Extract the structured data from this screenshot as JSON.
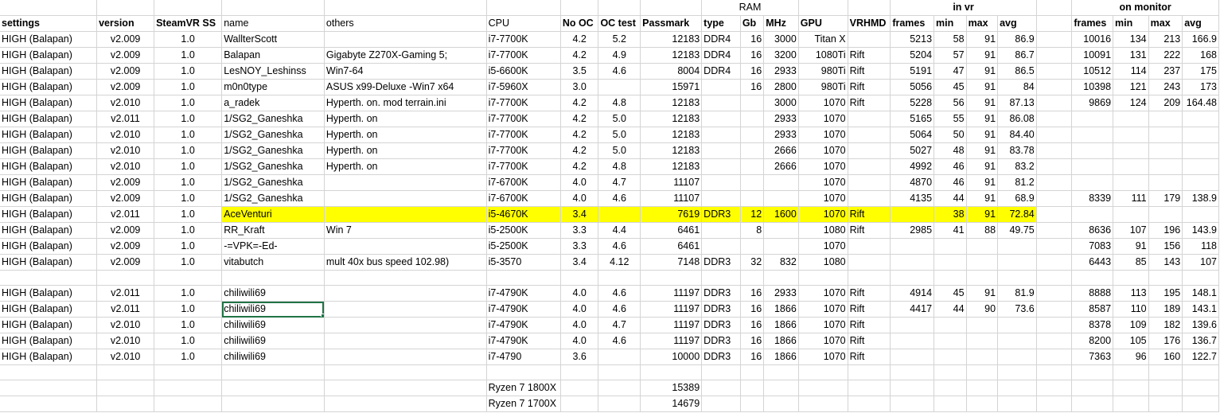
{
  "group_headers": {
    "ram": "RAM",
    "in_vr": "in vr",
    "on_monitor": "on monitor"
  },
  "headers": {
    "settings": "settings",
    "version": "version",
    "steamvr_ss": "SteamVR SS",
    "name": "name",
    "others": "others",
    "cpu": "CPU",
    "no_oc": "No OC",
    "oc_test": "OC test",
    "passmark": "Passmark",
    "ram_type": "type",
    "ram_gb": "Gb",
    "ram_mhz": "MHz",
    "gpu": "GPU",
    "vrhmd": "VRHMD",
    "vr_frames": "frames",
    "vr_min": "min",
    "vr_max": "max",
    "vr_avg": "avg",
    "mon_frames": "frames",
    "mon_min": "min",
    "mon_max": "max",
    "mon_avg": "avg"
  },
  "rows": [
    [
      "HIGH (Balapan)",
      "v2.009",
      "1.0",
      "WallterScott",
      "",
      "i7-7700K",
      "4.2",
      "5.2",
      "12183",
      "DDR4",
      "16",
      "3000",
      "Titan X",
      "",
      "5213",
      "58",
      "91",
      "86.9",
      "10016",
      "134",
      "213",
      "166.9"
    ],
    [
      "HIGH (Balapan)",
      "v2.009",
      "1.0",
      "Balapan",
      "Gigabyte Z270X-Gaming 5;",
      "i7-7700K",
      "4.2",
      "4.9",
      "12183",
      "DDR4",
      "16",
      "3200",
      "1080Ti",
      "Rift",
      "5204",
      "57",
      "91",
      "86.7",
      "10091",
      "131",
      "222",
      "168"
    ],
    [
      "HIGH (Balapan)",
      "v2.009",
      "1.0",
      "LesNOY_Leshinss",
      "Win7-64",
      "i5-6600K",
      "3.5",
      "4.6",
      "8004",
      "DDR4",
      "16",
      "2933",
      "980Ti",
      "Rift",
      "5191",
      "47",
      "91",
      "86.5",
      "10512",
      "114",
      "237",
      "175"
    ],
    [
      "HIGH (Balapan)",
      "v2.009",
      "1.0",
      "m0n0type",
      "ASUS x99-Deluxe -Win7 x64",
      "i7-5960X",
      "3.0",
      "",
      "15971",
      "",
      "16",
      "2800",
      "980Ti",
      "Rift",
      "5056",
      "45",
      "91",
      "84",
      "10398",
      "121",
      "243",
      "173"
    ],
    [
      "HIGH (Balapan)",
      "v2.010",
      "1.0",
      "a_radek",
      "Hyperth. on.  mod terrain.ini",
      "i7-7700K",
      "4.2",
      "4.8",
      "12183",
      "",
      "",
      "3000",
      "1070",
      "Rift",
      "5228",
      "56",
      "91",
      "87.13",
      "9869",
      "124",
      "209",
      "164.48"
    ],
    [
      "HIGH (Balapan)",
      "v2.011",
      "1.0",
      "1/SG2_Ganeshka",
      "Hyperth. on",
      "i7-7700K",
      "4.2",
      "5.0",
      "12183",
      "",
      "",
      "2933",
      "1070",
      "",
      "5165",
      "55",
      "91",
      "86.08",
      "",
      "",
      "",
      ""
    ],
    [
      "HIGH (Balapan)",
      "v2.010",
      "1.0",
      "1/SG2_Ganeshka",
      "Hyperth. on",
      "i7-7700K",
      "4.2",
      "5.0",
      "12183",
      "",
      "",
      "2933",
      "1070",
      "",
      "5064",
      "50",
      "91",
      "84.40",
      "",
      "",
      "",
      ""
    ],
    [
      "HIGH (Balapan)",
      "v2.010",
      "1.0",
      "1/SG2_Ganeshka",
      "Hyperth. on",
      "i7-7700K",
      "4.2",
      "5.0",
      "12183",
      "",
      "",
      "2666",
      "1070",
      "",
      "5027",
      "48",
      "91",
      "83.78",
      "",
      "",
      "",
      ""
    ],
    [
      "HIGH (Balapan)",
      "v2.010",
      "1.0",
      "1/SG2_Ganeshka",
      "Hyperth. on",
      "i7-7700K",
      "4.2",
      "4.8",
      "12183",
      "",
      "",
      "2666",
      "1070",
      "",
      "4992",
      "46",
      "91",
      "83.2",
      "",
      "",
      "",
      ""
    ],
    [
      "HIGH (Balapan)",
      "v2.009",
      "1.0",
      "1/SG2_Ganeshka",
      "",
      "i7-6700K",
      "4.0",
      "4.7",
      "11107",
      "",
      "",
      "",
      "1070",
      "",
      "4870",
      "46",
      "91",
      "81.2",
      "",
      "",
      "",
      ""
    ],
    [
      "HIGH (Balapan)",
      "v2.009",
      "1.0",
      "1/SG2_Ganeshka",
      "",
      "i7-6700K",
      "4.0",
      "4.6",
      "11107",
      "",
      "",
      "",
      "1070",
      "",
      "4135",
      "44",
      "91",
      "68.9",
      "8339",
      "111",
      "179",
      "138.9"
    ],
    [
      "HIGH (Balapan)",
      "v2.011",
      "1.0",
      "AceVenturi",
      "",
      "i5-4670K",
      "3.4",
      "",
      "7619",
      "DDR3",
      "12",
      "1600",
      "1070",
      "Rift",
      "",
      "38",
      "91",
      "72.84",
      "",
      "",
      "",
      ""
    ],
    [
      "HIGH (Balapan)",
      "v2.009",
      "1.0",
      "RR_Kraft",
      "Win 7",
      "i5-2500K",
      "3.3",
      "4.4",
      "6461",
      "",
      "8",
      "",
      "1080",
      "Rift",
      "2985",
      "41",
      "88",
      "49.75",
      "8636",
      "107",
      "196",
      "143.9"
    ],
    [
      "HIGH (Balapan)",
      "v2.009",
      "1.0",
      "-=VPK=-Ed-",
      "",
      "i5-2500K",
      "3.3",
      "4.6",
      "6461",
      "",
      "",
      "",
      "1070",
      "",
      "",
      "",
      "",
      "",
      "7083",
      "91",
      "156",
      "118"
    ],
    [
      "HIGH (Balapan)",
      "v2.009",
      "1.0",
      "vitabutch",
      "  mult 40x bus speed 102.98)",
      "i5-3570",
      "3.4",
      "4.12",
      "7148",
      "DDR3",
      "32",
      "832",
      "1080",
      "",
      "",
      "",
      "",
      "",
      "6443",
      "85",
      "143",
      "107"
    ],
    [
      "",
      "",
      "",
      "",
      "",
      "",
      "",
      "",
      "",
      "",
      "",
      "",
      "",
      "",
      "",
      "",
      "",
      "",
      "",
      "",
      "",
      ""
    ],
    [
      "HIGH (Balapan)",
      "v2.011",
      "1.0",
      "chiliwili69",
      "",
      "i7-4790K",
      "4.0",
      "4.6",
      "11197",
      "DDR3",
      "16",
      "2933",
      "1070",
      "Rift",
      "4914",
      "45",
      "91",
      "81.9",
      "8888",
      "113",
      "195",
      "148.1"
    ],
    [
      "HIGH (Balapan)",
      "v2.011",
      "1.0",
      "chiliwili69",
      "",
      "i7-4790K",
      "4.0",
      "4.6",
      "11197",
      "DDR3",
      "16",
      "1866",
      "1070",
      "Rift",
      "4417",
      "44",
      "90",
      "73.6",
      "8587",
      "110",
      "189",
      "143.1"
    ],
    [
      "HIGH (Balapan)",
      "v2.010",
      "1.0",
      "chiliwili69",
      "",
      "i7-4790K",
      "4.0",
      "4.7",
      "11197",
      "DDR3",
      "16",
      "1866",
      "1070",
      "Rift",
      "",
      "",
      "",
      "",
      "8378",
      "109",
      "182",
      "139.6"
    ],
    [
      "HIGH (Balapan)",
      "v2.010",
      "1.0",
      "chiliwili69",
      "",
      "i7-4790K",
      "4.0",
      "4.6",
      "11197",
      "DDR3",
      "16",
      "1866",
      "1070",
      "Rift",
      "",
      "",
      "",
      "",
      "8200",
      "105",
      "176",
      "136.7"
    ],
    [
      "HIGH (Balapan)",
      "v2.010",
      "1.0",
      "chiliwili69",
      "",
      "i7-4790",
      "3.6",
      "",
      "10000",
      "DDR3",
      "16",
      "1866",
      "1070",
      "Rift",
      "",
      "",
      "",
      "",
      "7363",
      "96",
      "160",
      "122.7"
    ],
    [
      "",
      "",
      "",
      "",
      "",
      "",
      "",
      "",
      "",
      "",
      "",
      "",
      "",
      "",
      "",
      "",
      "",
      "",
      "",
      "",
      "",
      ""
    ],
    [
      "",
      "",
      "",
      "",
      "",
      "Ryzen 7 1800X",
      "",
      "",
      "15389",
      "",
      "",
      "",
      "",
      "",
      "",
      "",
      "",
      "",
      "",
      "",
      "",
      ""
    ],
    [
      "",
      "",
      "",
      "",
      "",
      "Ryzen 7 1700X",
      "",
      "",
      "14679",
      "",
      "",
      "",
      "",
      "",
      "",
      "",
      "",
      "",
      "",
      "",
      "",
      ""
    ]
  ]
}
